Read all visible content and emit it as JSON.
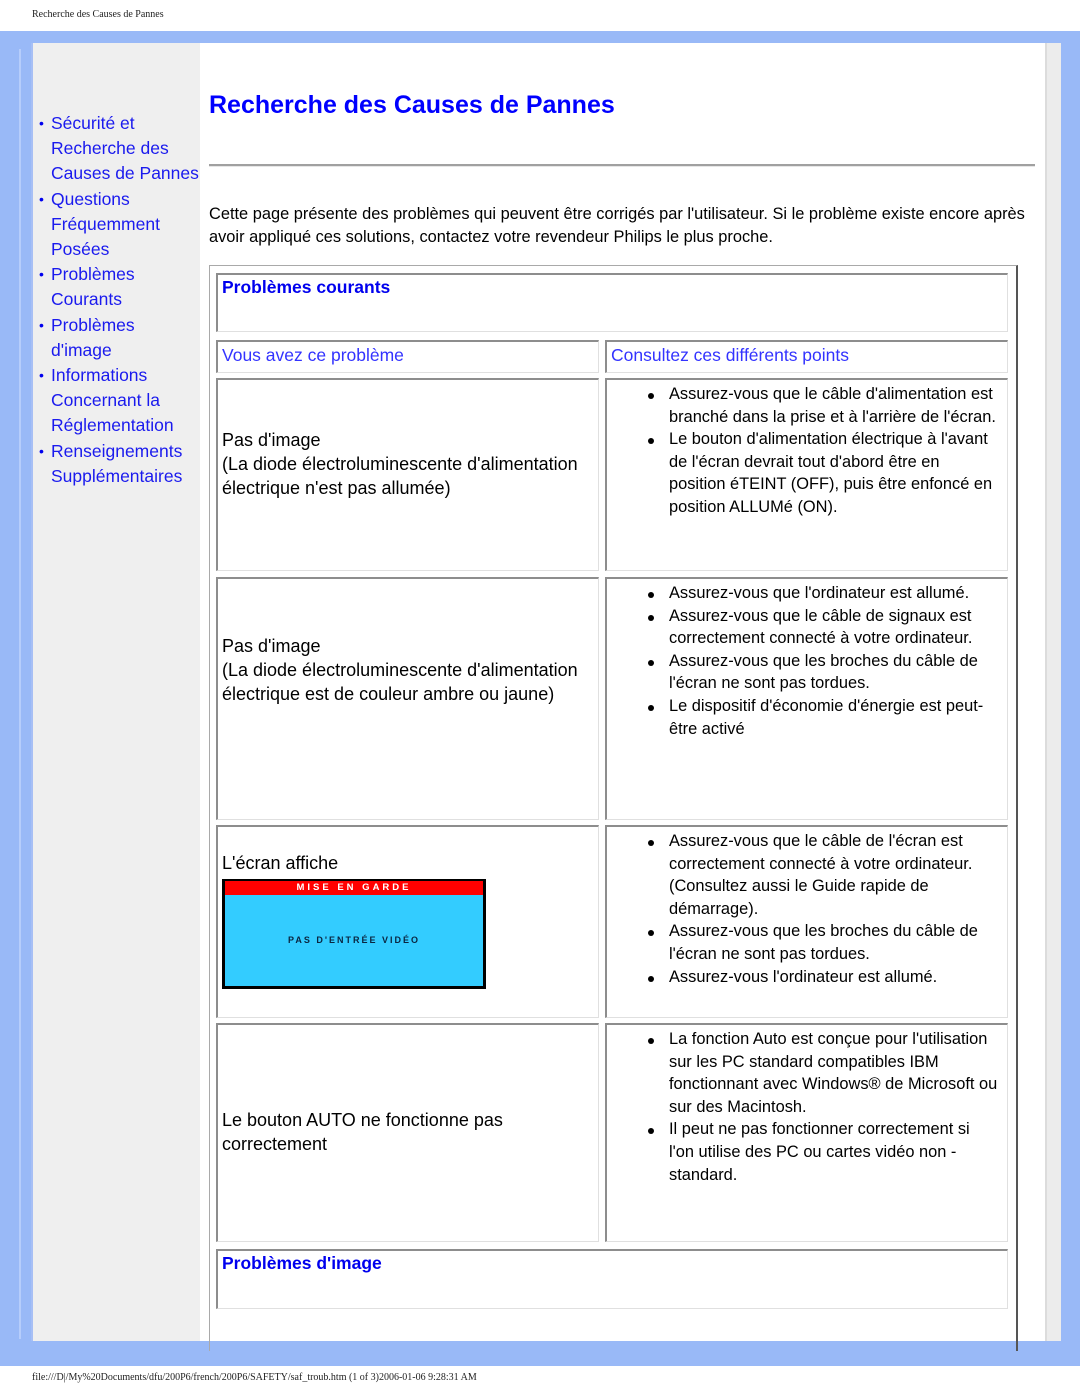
{
  "print_header": "Recherche des Causes de Pannes",
  "print_footer": "file:///D|/My%20Documents/dfu/200P6/french/200P6/SAFETY/saf_troub.htm (1 of 3)2006-01-06 9:28:31 AM",
  "colors": {
    "frame": "#99b9f7",
    "sidebar": "#efefef",
    "link": "#1a1aee",
    "title": "#0000ff",
    "osd_header": "#ff0000",
    "osd_body": "#33ccff"
  },
  "sidebar": {
    "items": [
      {
        "label": "Sécurité et Recherche des Causes de Pannes"
      },
      {
        "label": "Questions Fréquemment Posées"
      },
      {
        "label": "Problèmes Courants"
      },
      {
        "label": "Problèmes d'image"
      },
      {
        "label": "Informations Concernant la Réglementation"
      },
      {
        "label": "Renseignements Supplémentaires"
      }
    ]
  },
  "main": {
    "title": "Recherche des Causes de Pannes",
    "intro": "Cette page présente des problèmes qui peuvent être corrigés par l'utilisateur. Si le problème existe encore après avoir appliqué ces solutions, contactez votre revendeur Philips le plus proche.",
    "section_common": "Problèmes courants",
    "col_problem": "Vous avez ce problème",
    "col_solution": "Consultez ces différents points",
    "rows": [
      {
        "problem_title": "Pas d'image",
        "problem_detail": "(La diode électroluminescente d'alimentation électrique n'est pas allumée)",
        "points": [
          "Assurez-vous que le câble d'alimentation est branché dans la prise et à l'arrière de l'écran.",
          "Le bouton d'alimentation électrique à l'avant de l'écran devrait tout d'abord être en position éTEINT (OFF), puis être enfoncé en position ALLUMé (ON)."
        ]
      },
      {
        "problem_title": "Pas d'image",
        "problem_detail": "(La diode électroluminescente d'alimentation électrique est de couleur ambre ou jaune)",
        "points": [
          "Assurez-vous que l'ordinateur est allumé.",
          "Assurez-vous que le câble de signaux est correctement connecté à votre ordinateur.",
          "Assurez-vous que les broches du câble de l'écran ne sont pas tordues.",
          "Le dispositif d'économie d'énergie est peut-être activé"
        ]
      },
      {
        "problem_title": "L'écran affiche",
        "osd_header": "MISE EN GARDE",
        "osd_message": "PAS D'ENTRÉE VIDÉO",
        "points": [
          "Assurez-vous que le câble de l'écran est correctement connecté à votre ordinateur. (Consultez aussi le Guide rapide de démarrage).",
          "Assurez-vous que les broches du câble de l'écran ne sont pas tordues.",
          "Assurez-vous l'ordinateur est allumé."
        ]
      },
      {
        "problem_title": "Le bouton AUTO ne fonctionne pas correctement",
        "points": [
          "La fonction Auto est conçue pour l'utilisation sur les PC standard compatibles IBM fonctionnant avec Windows® de Microsoft ou sur des Macintosh.",
          "Il peut ne pas fonctionner correctement si l'on utilise des PC ou cartes vidéo non - standard."
        ]
      }
    ],
    "section_image": "Problèmes d'image"
  }
}
